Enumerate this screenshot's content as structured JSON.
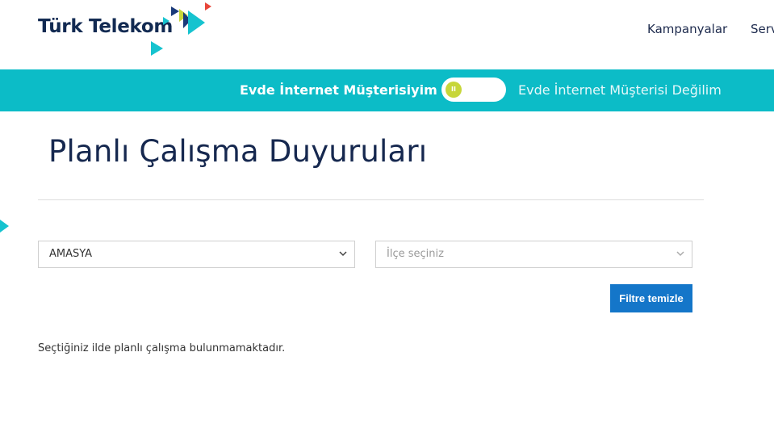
{
  "header": {
    "logo_text": "Türk Telekom",
    "nav": [
      "Kampanyalar",
      "Serv"
    ]
  },
  "segment": {
    "left_label": "Evde İnternet Müşterisiyim",
    "right_label": "Evde İnternet Müşterisi Değilim",
    "toggle_icon": "II"
  },
  "page": {
    "title": "Planlı Çalışma Duyuruları"
  },
  "filters": {
    "city_value": "AMASYA",
    "district_placeholder": "İlçe seçiniz",
    "clear_button": "Filtre temizle"
  },
  "result": {
    "message": "Seçtiğiniz ilde planlı çalışma bulunmamaktadır."
  },
  "colors": {
    "teal": "#0cbcc7",
    "navy": "#122a52",
    "button_blue": "#1476c9",
    "knob": "#c7d63a"
  }
}
